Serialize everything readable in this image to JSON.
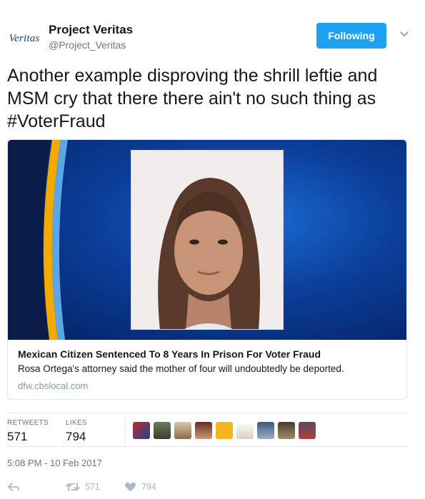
{
  "tweet": {
    "author": {
      "logo_text": "Veritas",
      "name": "Project Veritas",
      "handle": "@Project_Veritas"
    },
    "follow_button_label": "Following",
    "text": "Another example disproving the shrill leftie and MSM cry that there there ain't no such thing as #VoterFraud",
    "card": {
      "title": "Mexican Citizen Sentenced To 8 Years In Prison For Voter Fraud",
      "description": "Rosa Ortega's attorney said the mother of four will undoubtedly be deported.",
      "domain": "dfw.cbslocal.com"
    },
    "stats": {
      "retweets_label": "RETWEETS",
      "retweets_value": "571",
      "likes_label": "LIKES",
      "likes_value": "794"
    },
    "timestamp": "5:08 PM - 10 Feb 2017",
    "actions": {
      "retweet_count": "571",
      "like_count": "794"
    }
  },
  "icons": {
    "chevron": "chevron-down-icon",
    "reply": "reply-icon",
    "retweet": "retweet-icon",
    "like": "heart-icon"
  },
  "colors": {
    "accent": "#1da1f2",
    "muted": "#657786",
    "action_gray": "#aab8c2",
    "border": "#e1e8ed"
  }
}
